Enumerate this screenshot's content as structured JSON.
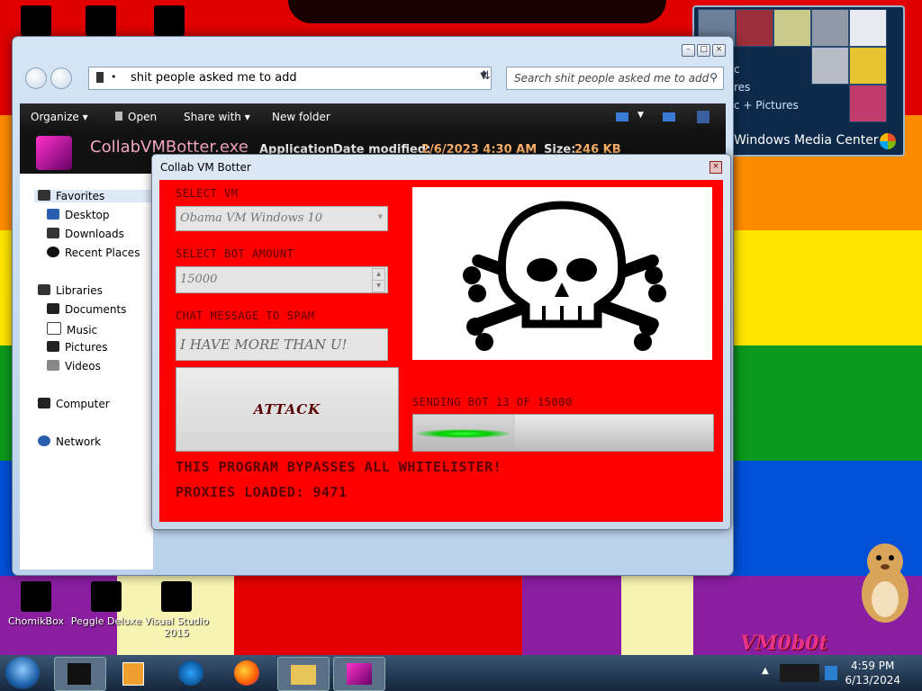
{
  "explorer": {
    "address": "shit people asked me to add",
    "search_placeholder": "Search shit people asked me to add",
    "toolbar": {
      "organize": "Organize",
      "open": "Open",
      "share_with": "Share with",
      "new_folder": "New folder"
    },
    "details": {
      "file_name": "CollabVMBotter.exe",
      "type": "Application",
      "date_label": "Date modified:",
      "date_value": "2/6/2023 4:30 AM",
      "size_label": "Size:",
      "size_value": "246 KB"
    },
    "nav": {
      "favorites": "Favorites",
      "desktop": "Desktop",
      "downloads": "Downloads",
      "recent_places": "Recent Places",
      "libraries": "Libraries",
      "documents": "Documents",
      "music": "Music",
      "pictures": "Pictures",
      "videos": "Videos",
      "computer": "Computer",
      "network": "Network"
    }
  },
  "botter": {
    "title": "Collab VM Botter",
    "select_vm_label": "SELECT VM",
    "select_vm_value": "Obama VM Windows 10",
    "bot_amount_label": "SELECT BOT AMOUNT",
    "bot_amount_value": "15000",
    "chat_label": "CHAT MESSAGE TO SPAM",
    "chat_value": "I HAVE MORE THAN U!",
    "attack_label": "ATTACK",
    "progress_label": "SENDING BOT 13 OF 15000",
    "progress_fraction": 0.34,
    "bypass_text": "THIS PROGRAM BYPASSES ALL WHITELISTER!",
    "proxies_text": "PROXIES LOADED: 9471"
  },
  "media_center": {
    "line1": "c",
    "line2": "res",
    "line3": "c + Pictures",
    "title": "Windows Media Center"
  },
  "desktop_icons": {
    "chomikbox": "ChomikBox",
    "peggle": "Peggle Deluxe",
    "visualstudio": "Visual Studio 2015"
  },
  "brand": "VM0b0t",
  "taskbar": {
    "time": "4:59 PM",
    "date": "6/13/2024"
  },
  "colors": {
    "bot_bg": "#ff0000",
    "rainbow": [
      "#e00000",
      "#ff8c00",
      "#ffe600",
      "#0c9a1c",
      "#0050d8",
      "#8a1ea0"
    ]
  }
}
